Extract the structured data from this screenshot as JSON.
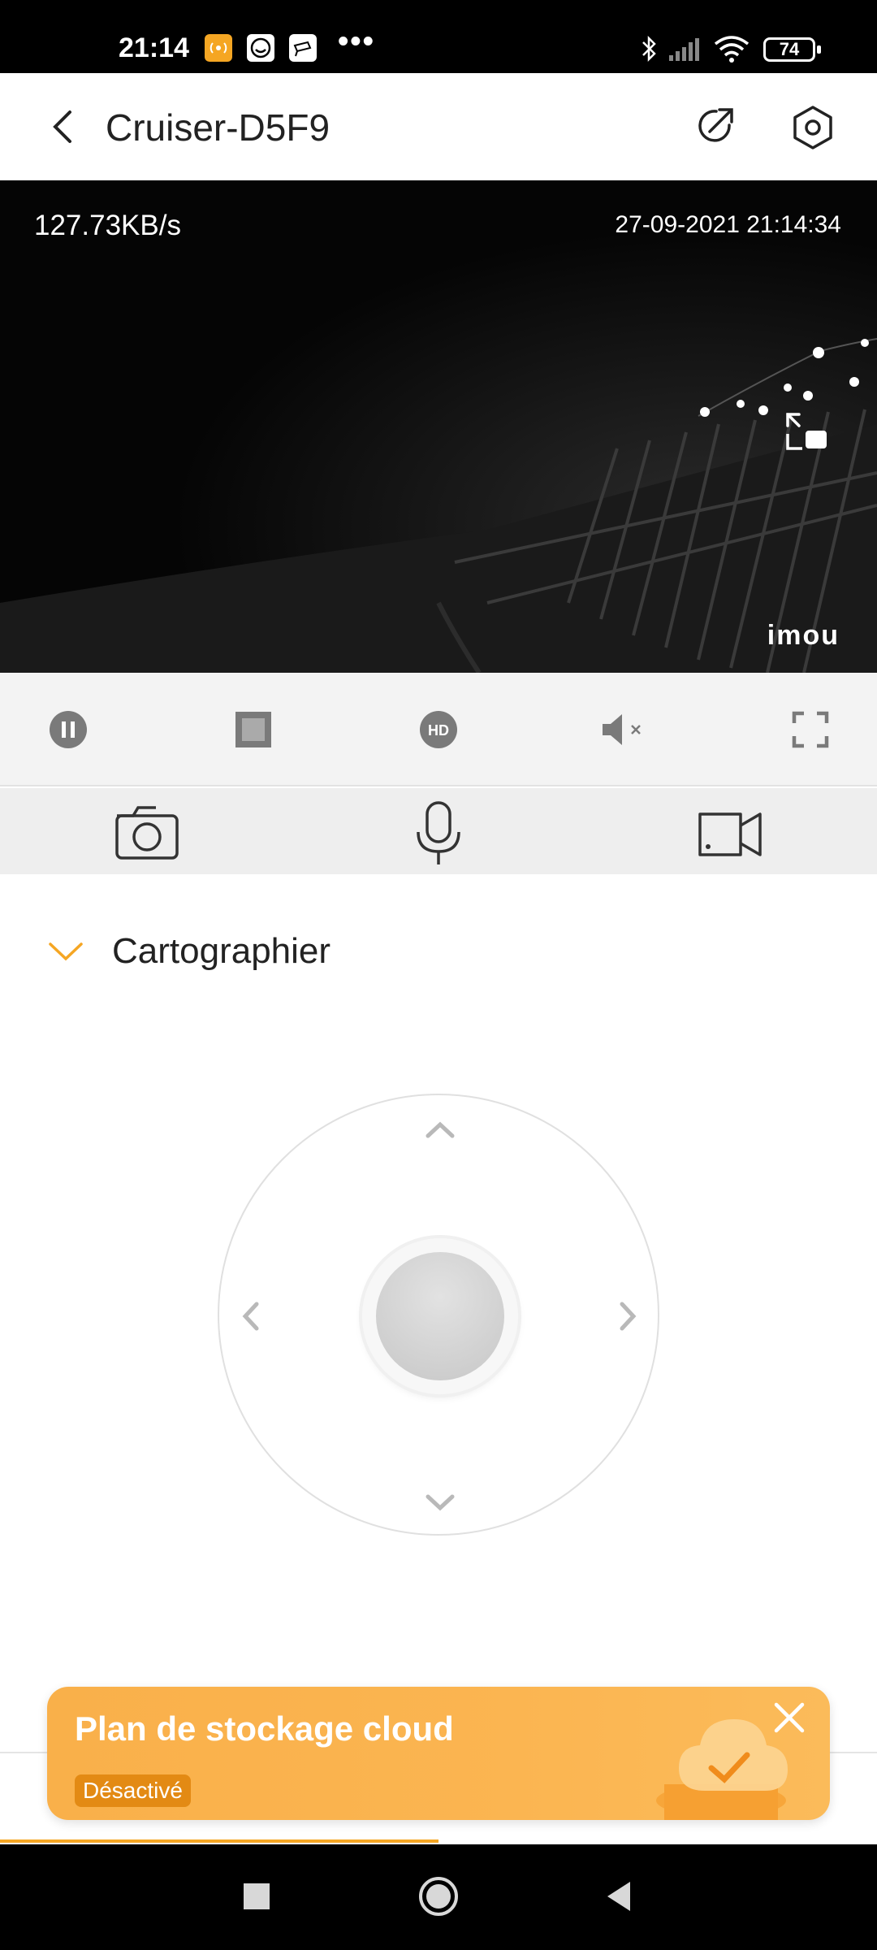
{
  "status_bar": {
    "time": "21:14",
    "more": "•••",
    "battery": "74",
    "icons": [
      "hotspot-icon",
      "smiley-app-icon",
      "camera-app-icon",
      "bluetooth-icon",
      "signal-icon",
      "wifi-icon"
    ]
  },
  "header": {
    "title": "Cruiser-D5F9",
    "icons": [
      "back-icon",
      "share-icon",
      "settings-icon"
    ]
  },
  "video": {
    "bitrate": "127.73KB/s",
    "timestamp": "27-09-2021 21:14:34",
    "watermark": "imou"
  },
  "controls": [
    "pause-icon",
    "stop-icon",
    "hd-icon",
    "mute-icon",
    "fullscreen-icon"
  ],
  "actions": [
    "snapshot-icon",
    "microphone-icon",
    "record-video-icon"
  ],
  "section": {
    "title": "Cartographier"
  },
  "banner": {
    "title": "Plan de stockage cloud",
    "status": "Désactivé"
  },
  "colors": {
    "accent": "#f5a623",
    "banner": "#fbb551"
  }
}
